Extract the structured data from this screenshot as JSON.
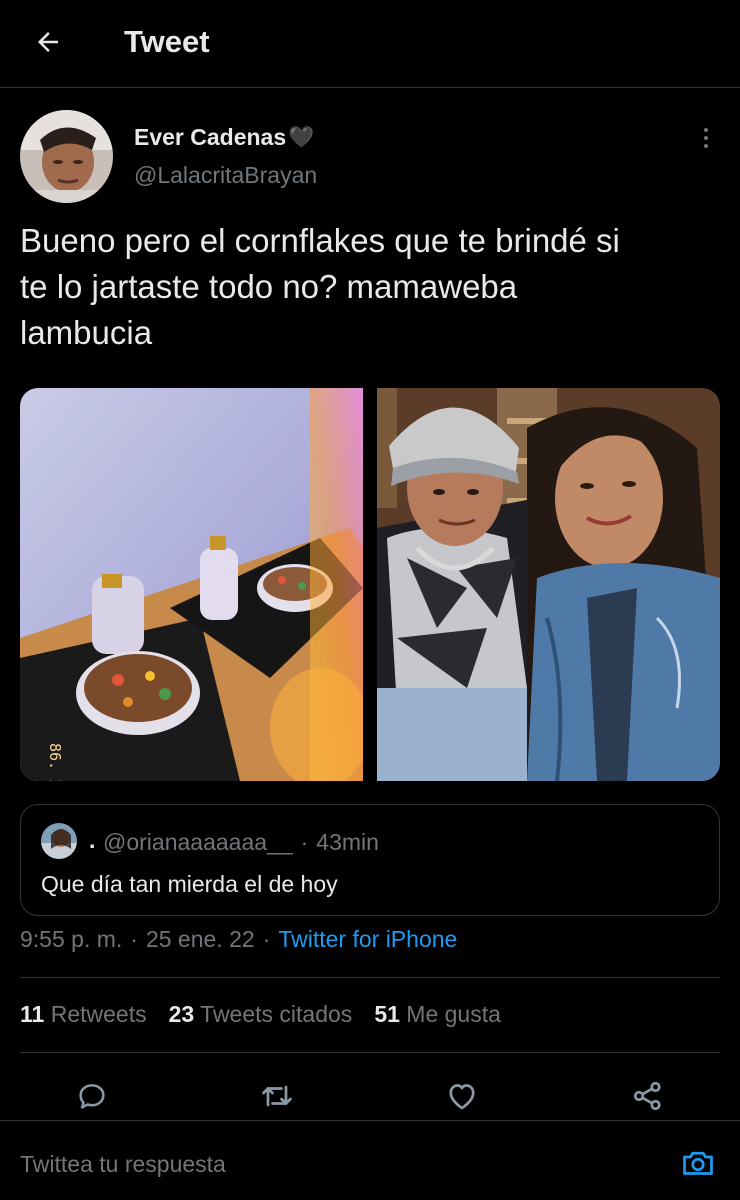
{
  "header": {
    "title": "Tweet",
    "back_icon": "arrow-left-icon"
  },
  "author": {
    "name": "Ever Cadenas",
    "name_emoji": "🖤",
    "handle": "@LalacritaBrayan"
  },
  "tweet": {
    "text": "Bueno pero el cornflakes que te brindé si\nte lo jartaste todo no? mamaweba\nlambucia",
    "photo_1_stamp": "86. I 52"
  },
  "quoted": {
    "prefix": ".",
    "handle": "@orianaaaaaaa__",
    "separator": "·",
    "time": "43min",
    "text": "Que día tan mierda el de hoy"
  },
  "meta": {
    "time": "9:55 p. m.",
    "sep1": "·",
    "date": "25 ene. 22",
    "sep2": "·",
    "source": "Twitter for iPhone"
  },
  "stats": [
    {
      "count": "11",
      "label": "Retweets"
    },
    {
      "count": "23",
      "label": "Tweets citados"
    },
    {
      "count": "51",
      "label": "Me gusta"
    }
  ],
  "actions": [
    "reply-icon",
    "retweet-icon",
    "like-icon",
    "share-icon"
  ],
  "reply": {
    "placeholder": "Twittea tu respuesta"
  },
  "colors": {
    "background": "#000000",
    "text": "#e7e9ea",
    "muted": "#71767b",
    "link": "#1d9bf0",
    "border": "#2f3336"
  }
}
